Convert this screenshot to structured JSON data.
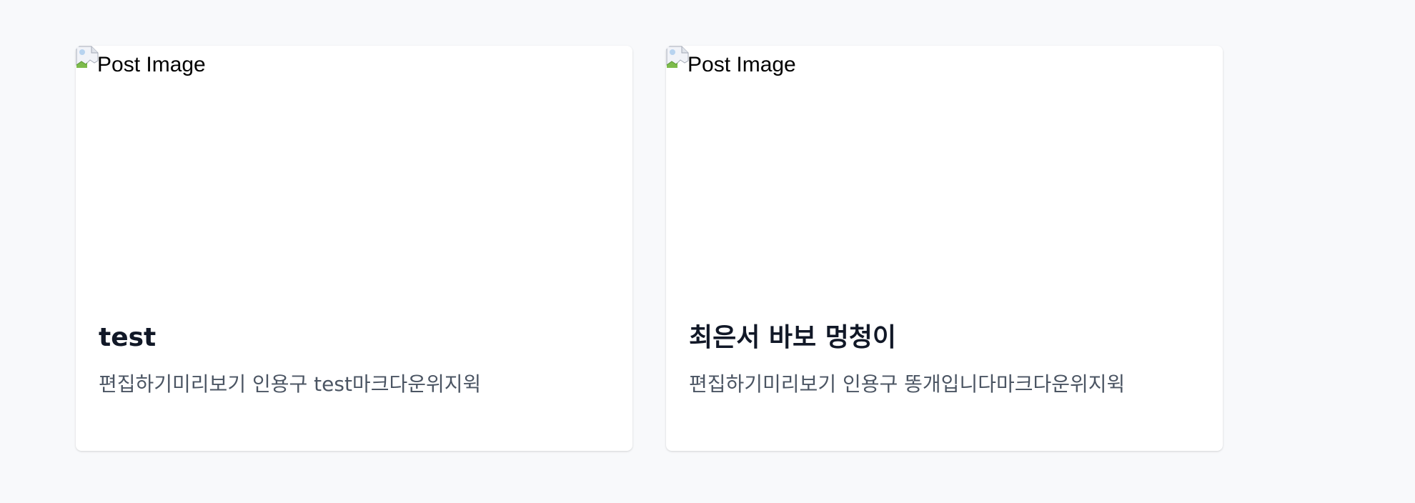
{
  "posts": [
    {
      "image_alt": "Post Image",
      "title": "test",
      "excerpt": "편집하기미리보기 인용구 test마크다운위지윅"
    },
    {
      "image_alt": "Post Image",
      "title": "최은서 바보 멍청이",
      "excerpt": "편집하기미리보기 인용구 똥개입니다마크다운위지윅"
    }
  ],
  "colors": {
    "page_background": "#f8f9fb",
    "card_background": "#ffffff",
    "title_text": "#111827",
    "excerpt_text": "#4b5563"
  },
  "icons": {
    "broken_image": "broken-image-icon"
  }
}
